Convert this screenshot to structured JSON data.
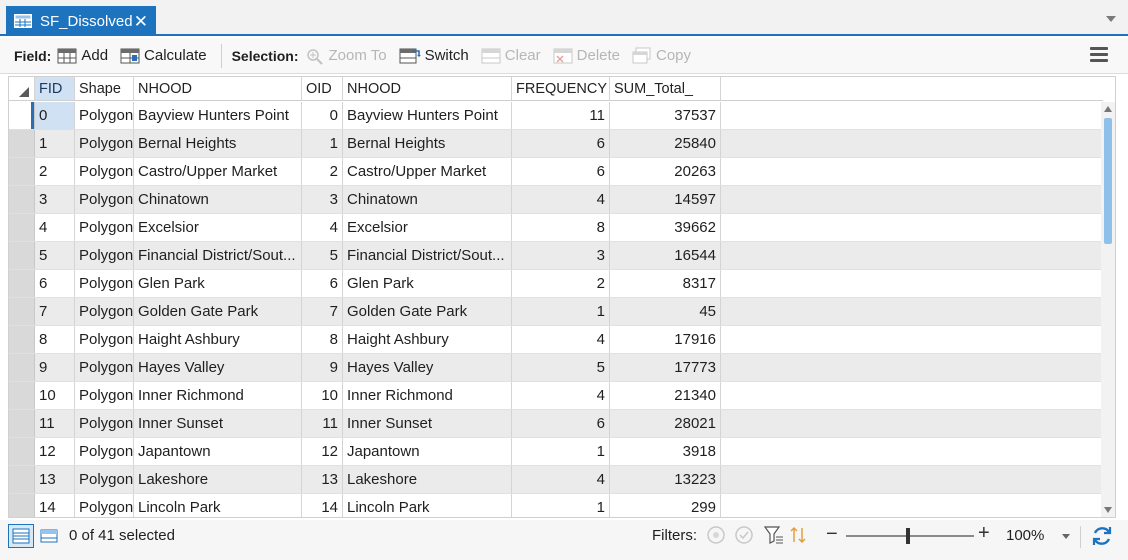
{
  "tab": {
    "title": "SF_Dissolved",
    "close_glyph": "✕"
  },
  "toolbar": {
    "field_label": "Field:",
    "add": "Add",
    "calculate": "Calculate",
    "selection_label": "Selection:",
    "zoom_to": "Zoom To",
    "switch": "Switch",
    "clear": "Clear",
    "delete": "Delete",
    "copy": "Copy"
  },
  "table": {
    "columns": [
      "FID",
      "Shape",
      "NHOOD",
      "OID",
      "NHOOD",
      "FREQUENCY",
      "SUM_Total_"
    ],
    "rows": [
      [
        "0",
        "Polygon",
        "Bayview Hunters Point",
        "0",
        "Bayview Hunters Point",
        "11",
        "37537"
      ],
      [
        "1",
        "Polygon",
        "Bernal Heights",
        "1",
        "Bernal Heights",
        "6",
        "25840"
      ],
      [
        "2",
        "Polygon",
        "Castro/Upper Market",
        "2",
        "Castro/Upper Market",
        "6",
        "20263"
      ],
      [
        "3",
        "Polygon",
        "Chinatown",
        "3",
        "Chinatown",
        "4",
        "14597"
      ],
      [
        "4",
        "Polygon",
        "Excelsior",
        "4",
        "Excelsior",
        "8",
        "39662"
      ],
      [
        "5",
        "Polygon",
        "Financial District/Sout...",
        "5",
        "Financial District/Sout...",
        "3",
        "16544"
      ],
      [
        "6",
        "Polygon",
        "Glen Park",
        "6",
        "Glen Park",
        "2",
        "8317"
      ],
      [
        "7",
        "Polygon",
        "Golden Gate Park",
        "7",
        "Golden Gate Park",
        "1",
        "45"
      ],
      [
        "8",
        "Polygon",
        "Haight Ashbury",
        "8",
        "Haight Ashbury",
        "4",
        "17916"
      ],
      [
        "9",
        "Polygon",
        "Hayes Valley",
        "9",
        "Hayes Valley",
        "5",
        "17773"
      ],
      [
        "10",
        "Polygon",
        "Inner Richmond",
        "10",
        "Inner Richmond",
        "4",
        "21340"
      ],
      [
        "11",
        "Polygon",
        "Inner Sunset",
        "11",
        "Inner Sunset",
        "6",
        "28021"
      ],
      [
        "12",
        "Polygon",
        "Japantown",
        "12",
        "Japantown",
        "1",
        "3918"
      ],
      [
        "13",
        "Polygon",
        "Lakeshore",
        "13",
        "Lakeshore",
        "4",
        "13223"
      ],
      [
        "14",
        "Polygon",
        "Lincoln Park",
        "14",
        "Lincoln Park",
        "1",
        "299"
      ]
    ]
  },
  "status": {
    "selected_text": "0 of 41 selected",
    "filters_label": "Filters:",
    "zoom_minus": "−",
    "zoom_plus": "+",
    "zoom_value": "100%"
  },
  "colors": {
    "accent": "#1e73be",
    "row_alt": "#ebebeb",
    "selected_header": "#cfe1f2"
  },
  "icons": [
    "table-icon",
    "close-icon",
    "add-field-icon",
    "calculate-icon",
    "zoom-to-icon",
    "switch-icon",
    "clear-icon",
    "delete-icon",
    "copy-icon",
    "menu-icon",
    "table-view-icon",
    "field-view-icon",
    "refresh-icon"
  ]
}
